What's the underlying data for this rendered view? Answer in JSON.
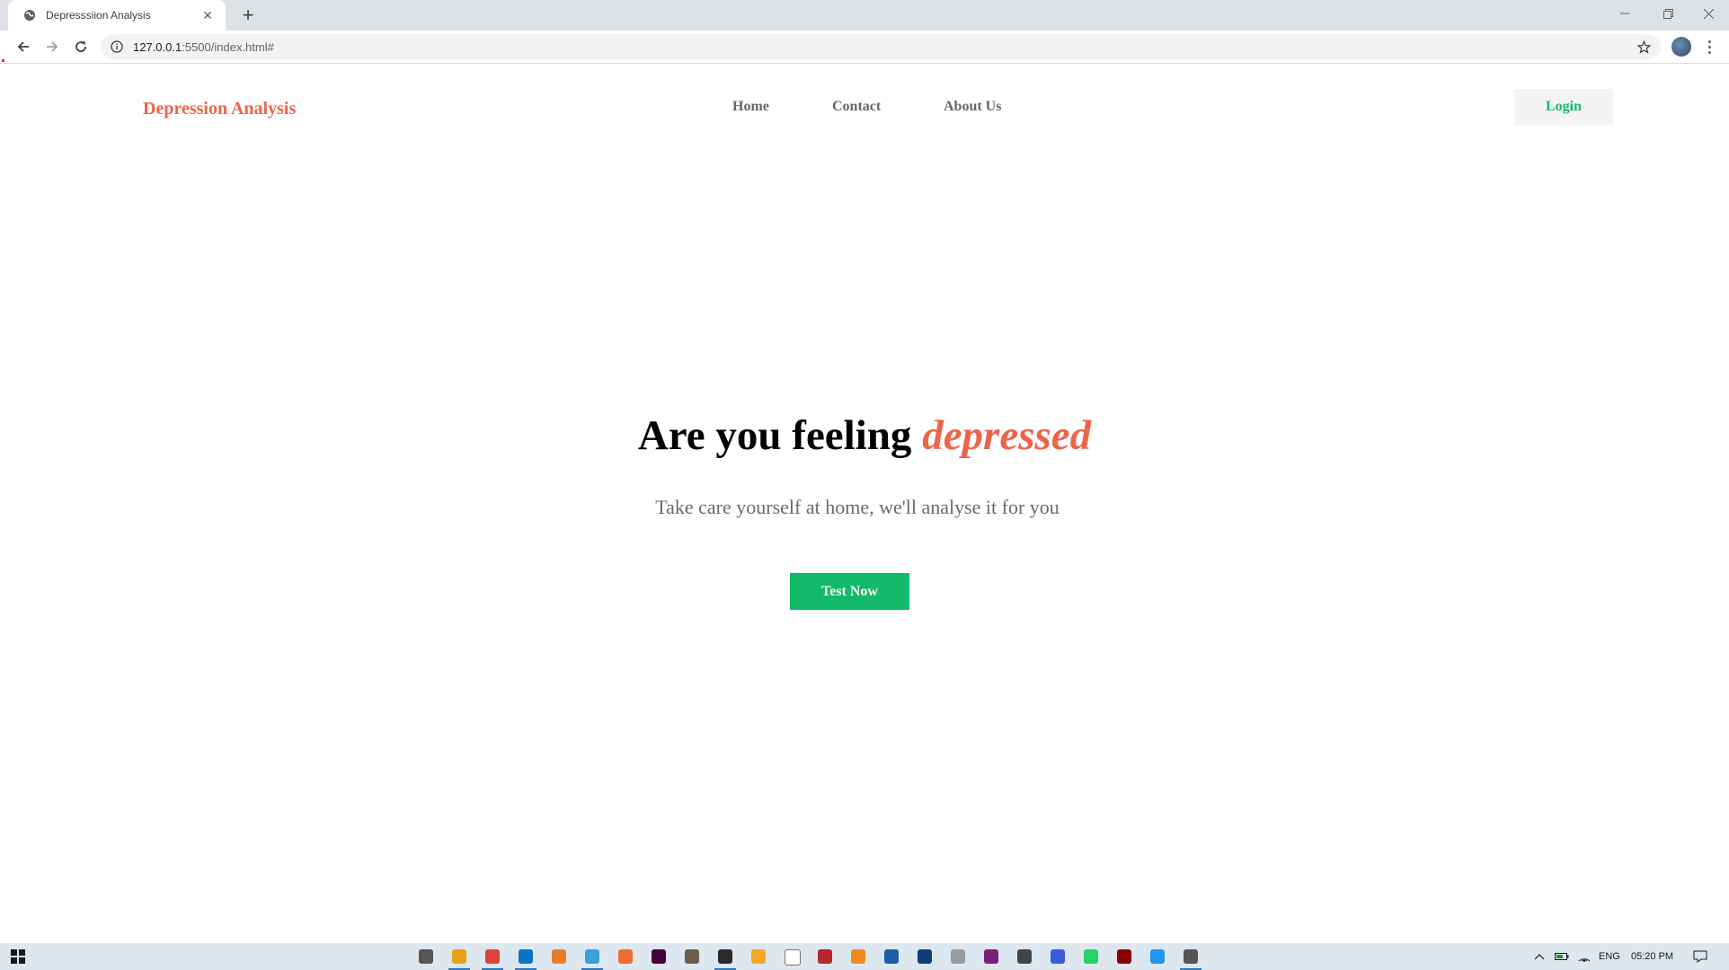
{
  "browser": {
    "tab_title": "Depresssiion Analysis",
    "url_host": "127.0.0.1",
    "url_rest": ":5500/index.html#"
  },
  "site": {
    "logo": "Depression Analysis",
    "nav": [
      "Home",
      "Contact",
      "About Us"
    ],
    "login_label": "Login"
  },
  "hero": {
    "title_prefix": "Are you feeling ",
    "title_accent": "depressed",
    "subtitle": "Take care yourself at home, we'll analyse it for you",
    "cta_label": "Test Now"
  },
  "colors": {
    "accent": "#ee6449",
    "green": "#13b96a",
    "nav_text": "#666666"
  },
  "taskbar": {
    "icons": [
      "settings-icon",
      "file-explorer-icon",
      "chrome-icon",
      "vscode-icon",
      "git-icon",
      "tool-icon",
      "browser-icon",
      "xd-icon",
      "gimp-icon",
      "app-icon",
      "sublime-icon",
      "notepad-icon",
      "filezilla-icon",
      "vlc-icon",
      "terminal-icon",
      "vnc-icon",
      "paint-icon",
      "winrar-icon",
      "camera-icon",
      "headphones-icon",
      "whatsapp-icon",
      "media-icon",
      "phone-icon",
      "pen-icon"
    ],
    "language": "ENG",
    "time": "05:20 PM"
  }
}
